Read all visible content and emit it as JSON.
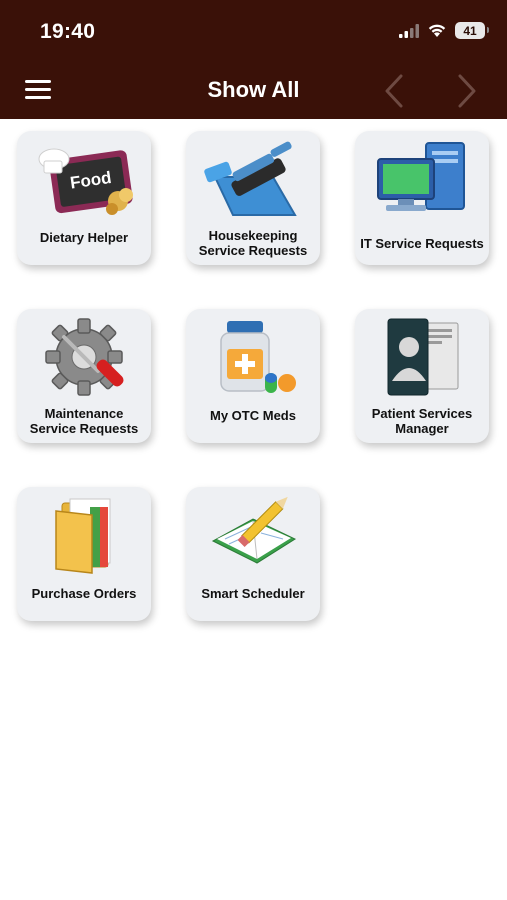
{
  "status_bar": {
    "time": "19:40",
    "battery": "41",
    "icons": [
      "signal-icon",
      "wifi-icon",
      "battery-icon"
    ]
  },
  "nav": {
    "title": "Show All",
    "menu_icon": "hamburger-menu-icon",
    "prev_icon": "chevron-left-icon",
    "next_icon": "chevron-right-icon"
  },
  "colors": {
    "header_bg": "#3a1108",
    "tile_bg": "#eef0f3"
  },
  "tiles": [
    {
      "label": "Dietary Helper",
      "icon": "food-chalkboard-icon",
      "icon_text": "Food"
    },
    {
      "label": "Housekeeping Service Requests",
      "icon": "dustpan-brush-icon"
    },
    {
      "label": "IT Service Requests",
      "icon": "computer-icon"
    },
    {
      "label": "Maintenance Service Requests",
      "icon": "gear-screwdriver-icon"
    },
    {
      "label": "My OTC Meds",
      "icon": "medicine-bottle-icon"
    },
    {
      "label": "Patient Services Manager",
      "icon": "patient-folder-icon"
    },
    {
      "label": "Purchase Orders",
      "icon": "file-folder-icon"
    },
    {
      "label": "Smart Scheduler",
      "icon": "notebook-pencil-icon"
    }
  ]
}
